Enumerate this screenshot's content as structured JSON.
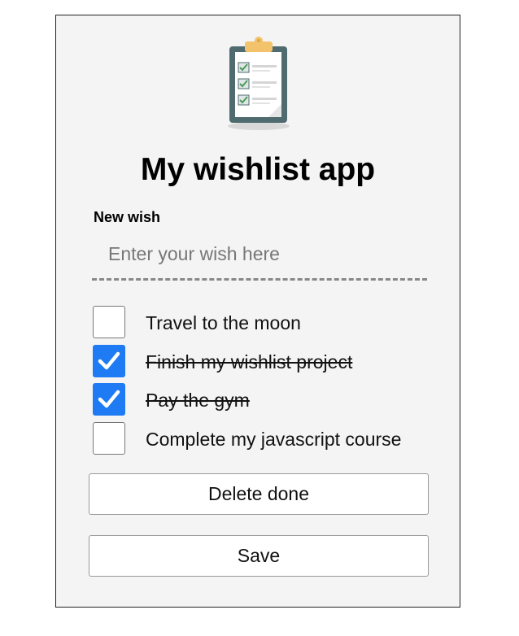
{
  "app": {
    "title": "My wishlist app",
    "logo_icon": "clipboard-checklist-icon"
  },
  "form": {
    "label": "New wish",
    "placeholder": "Enter your wish here",
    "value": ""
  },
  "wishes": [
    {
      "text": "Travel to the moon",
      "done": false
    },
    {
      "text": "Finish my wishlist project",
      "done": true
    },
    {
      "text": "Pay the gym",
      "done": true
    },
    {
      "text": "Complete my javascript course",
      "done": false
    }
  ],
  "buttons": {
    "delete_label": "Delete done",
    "save_label": "Save"
  },
  "colors": {
    "accent": "#1e7bf3",
    "panel_bg": "#f4f4f4",
    "clipboard_frame": "#4f6b6f",
    "clipboard_clip": "#f2c36b"
  }
}
